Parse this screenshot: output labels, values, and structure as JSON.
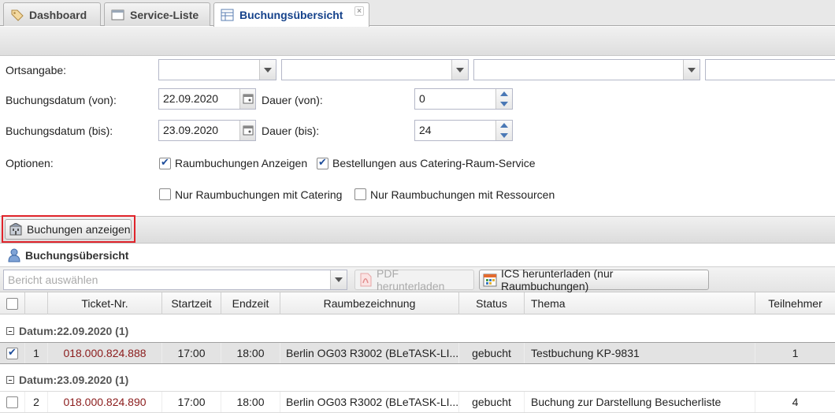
{
  "tabs": [
    {
      "label": "Dashboard"
    },
    {
      "label": "Service-Liste"
    },
    {
      "label": "Buchungsübersicht"
    }
  ],
  "filters": {
    "ortsangabe_label": "Ortsangabe:",
    "von_label": "Buchungsdatum (von):",
    "von_value": "22.09.2020",
    "bis_label": "Buchungsdatum (bis):",
    "bis_value": "23.09.2020",
    "dauer_von_label": "Dauer (von):",
    "dauer_von_value": "0",
    "dauer_bis_label": "Dauer (bis):",
    "dauer_bis_value": "24",
    "optionen_label": "Optionen:",
    "options": [
      {
        "label": "Raumbuchungen Anzeigen",
        "checked": true
      },
      {
        "label": "Bestellungen aus Catering-Raum-Service",
        "checked": true
      },
      {
        "label": "Nur Raumbuchungen mit Catering",
        "checked": false
      },
      {
        "label": "Nur Raumbuchungen mit Ressourcen",
        "checked": false
      }
    ]
  },
  "actions": {
    "show_bookings": "Buchungen anzeigen"
  },
  "panel": {
    "title": "Buchungsübersicht"
  },
  "grid_toolbar": {
    "report_placeholder": "Bericht auswählen",
    "pdf_label": "PDF herunterladen",
    "ics_label": "ICS herunterladen (nur Raumbuchungen)"
  },
  "columns": [
    "Ticket-Nr.",
    "Startzeit",
    "Endzeit",
    "Raumbezeichnung",
    "Status",
    "Thema",
    "Teilnehmer"
  ],
  "groups": [
    {
      "label": "Datum:22.09.2020 (1)",
      "rows": [
        {
          "num": "1",
          "checked": true,
          "ticket": "018.000.824.888",
          "start": "17:00",
          "end": "18:00",
          "room": "Berlin OG03 R3002 (BLeTASK-LI...",
          "status": "gebucht",
          "thema": "Testbuchung KP-9831",
          "teilnehmer": "1"
        }
      ]
    },
    {
      "label": "Datum:23.09.2020 (1)",
      "rows": [
        {
          "num": "2",
          "checked": false,
          "ticket": "018.000.824.890",
          "start": "17:00",
          "end": "18:00",
          "room": "Berlin OG03 R3002 (BLeTASK-LI...",
          "status": "gebucht",
          "thema": "Buchung zur Darstellung Besucherliste",
          "teilnehmer": "4"
        }
      ]
    }
  ],
  "colors": {
    "accent": "#15428b",
    "ticket": "#8b1c1c",
    "highlight": "#e0242b"
  }
}
